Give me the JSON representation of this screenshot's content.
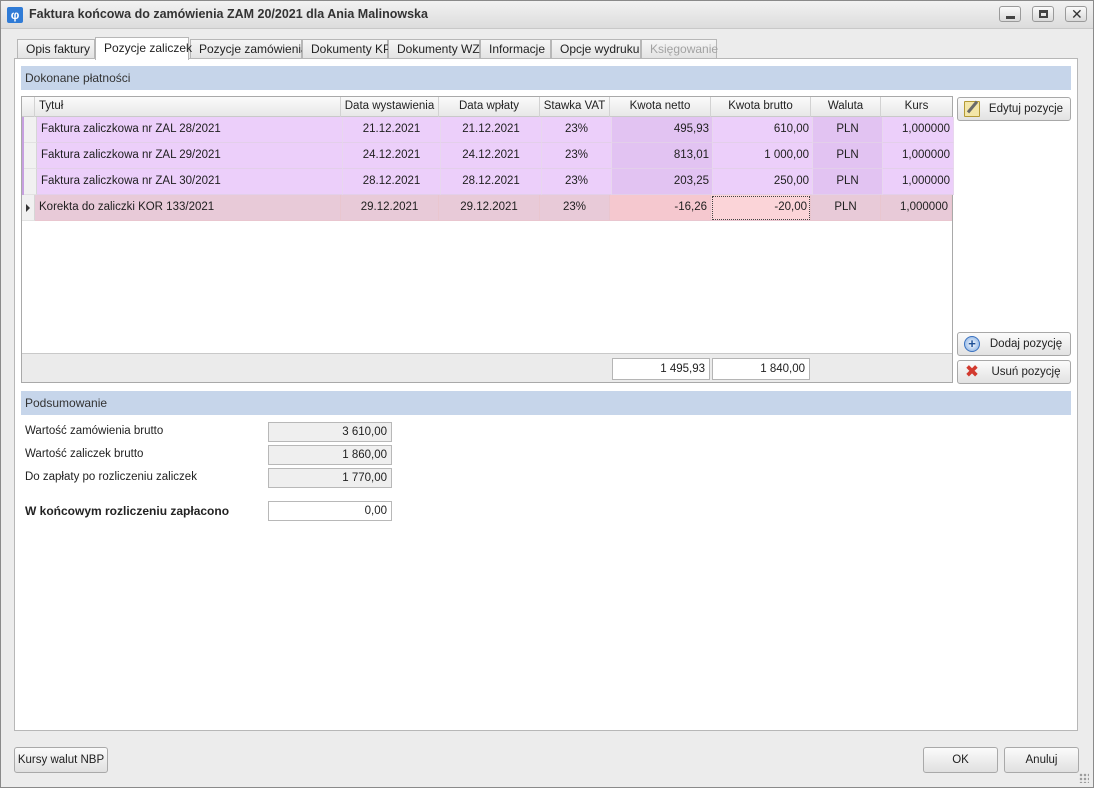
{
  "window": {
    "title": "Faktura końcowa do zamówienia ZAM 20/2021 dla Ania Malinowska",
    "icon": "app-phi-icon"
  },
  "tabs": [
    {
      "label": "Opis faktury",
      "active": false,
      "enabled": true
    },
    {
      "label": "Pozycje zaliczek",
      "active": true,
      "enabled": true
    },
    {
      "label": "Pozycje zamówienia",
      "active": false,
      "enabled": true
    },
    {
      "label": "Dokumenty KP",
      "active": false,
      "enabled": true
    },
    {
      "label": "Dokumenty WZ",
      "active": false,
      "enabled": true
    },
    {
      "label": "Informacje",
      "active": false,
      "enabled": true
    },
    {
      "label": "Opcje wydruku",
      "active": false,
      "enabled": true
    },
    {
      "label": "Księgowanie",
      "active": false,
      "enabled": false
    }
  ],
  "payments": {
    "section_title": "Dokonane płatności",
    "columns": [
      "Tytuł",
      "Data wystawienia",
      "Data wpłaty",
      "Stawka VAT",
      "Kwota netto",
      "Kwota brutto",
      "Waluta",
      "Kurs"
    ],
    "rows": [
      {
        "title": "Faktura zaliczkowa nr ZAL 28/2021",
        "issue_date": "21.12.2021",
        "payment_date": "21.12.2021",
        "vat": "23%",
        "net": "495,93",
        "gross": "610,00",
        "currency": "PLN",
        "rate": "1,000000"
      },
      {
        "title": "Faktura zaliczkowa nr ZAL 29/2021",
        "issue_date": "24.12.2021",
        "payment_date": "24.12.2021",
        "vat": "23%",
        "net": "813,01",
        "gross": "1 000,00",
        "currency": "PLN",
        "rate": "1,000000"
      },
      {
        "title": "Faktura zaliczkowa nr ZAL 30/2021",
        "issue_date": "28.12.2021",
        "payment_date": "28.12.2021",
        "vat": "23%",
        "net": "203,25",
        "gross": "250,00",
        "currency": "PLN",
        "rate": "1,000000"
      },
      {
        "title": "Korekta do zaliczki KOR 133/2021",
        "issue_date": "29.12.2021",
        "payment_date": "29.12.2021",
        "vat": "23%",
        "net": "-16,26",
        "gross": "-20,00",
        "currency": "PLN",
        "rate": "1,000000"
      }
    ],
    "totals": {
      "net": "1 495,93",
      "gross": "1 840,00"
    },
    "row_colors": {
      "advance": "#eccffa",
      "correction": "#e8cad8",
      "correction_amount": "#f5c8cf"
    }
  },
  "side_buttons": {
    "edit": {
      "label": "Edytuj pozycje",
      "icon": "edit-pencil-icon"
    },
    "add": {
      "label": "Dodaj pozycję",
      "icon": "add-plus-icon"
    },
    "remove": {
      "label": "Usuń pozycję",
      "icon": "delete-x-icon"
    }
  },
  "summary": {
    "section_title": "Podsumowanie",
    "order_gross_label": "Wartość zamówienia brutto",
    "order_gross_value": "3 610,00",
    "advances_gross_label": "Wartość zaliczek brutto",
    "advances_gross_value": "1 860,00",
    "to_pay_label": "Do zapłaty po rozliczeniu zaliczek",
    "to_pay_value": "1 770,00",
    "paid_final_label": "W końcowym rozliczeniu zapłacono",
    "paid_final_value": "0,00"
  },
  "footer": {
    "nbp_label": "Kursy walut NBP",
    "ok_label": "OK",
    "cancel_label": "Anuluj"
  }
}
